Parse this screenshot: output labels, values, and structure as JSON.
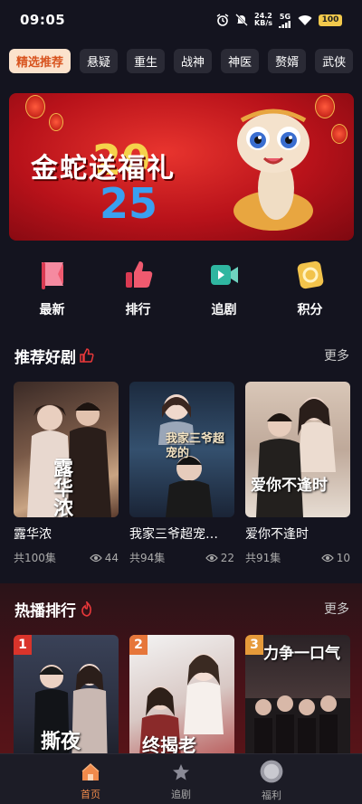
{
  "status_bar": {
    "time": "09:05",
    "net_speed_value": "24.2",
    "net_speed_unit": "KB/s",
    "signal": "5G",
    "battery": "100"
  },
  "categories": [
    "精选推荐",
    "悬疑",
    "重生",
    "战神",
    "神医",
    "赘婿",
    "武侠"
  ],
  "banner": {
    "title": "金蛇送福礼",
    "year_top": "20",
    "year_bottom": "25"
  },
  "quick_menu": [
    {
      "label": "最新",
      "icon": "flag-icon",
      "color": "#ef5a6f"
    },
    {
      "label": "排行",
      "icon": "thumbs-up-icon",
      "color": "#ef5a6f"
    },
    {
      "label": "追剧",
      "icon": "video-icon",
      "color": "#2fb6a0"
    },
    {
      "label": "积分",
      "icon": "coin-icon",
      "color": "#f2c34b"
    }
  ],
  "recommended": {
    "title": "推荐好剧",
    "more": "更多",
    "items": [
      {
        "title": "露华浓",
        "episodes": "共100集",
        "views": "44",
        "poster_text": "露华浓"
      },
      {
        "title": "我家三爷超宠…",
        "episodes": "共94集",
        "views": "22",
        "poster_text": "我家三爷超宠的"
      },
      {
        "title": "爱你不逢时",
        "episodes": "共91集",
        "views": "10",
        "poster_text": "爱你不逢时"
      }
    ]
  },
  "hot_ranking": {
    "title": "热播排行",
    "more": "更多",
    "items": [
      {
        "rank": "1",
        "poster_text": "撕夜",
        "badge_color": "#d9342b"
      },
      {
        "rank": "2",
        "poster_text": "终揭老",
        "badge_color": "#e6763a"
      },
      {
        "rank": "3",
        "poster_text": "力争一口气",
        "badge_color": "#e69a3a"
      }
    ]
  },
  "bottom_nav": [
    {
      "label": "首页",
      "icon": "home-icon",
      "active": true
    },
    {
      "label": "追剧",
      "icon": "star-icon",
      "active": false
    },
    {
      "label": "福利",
      "icon": "gift-icon",
      "active": false
    }
  ],
  "colors": {
    "accent": "#f08a4b",
    "active_tab_bg": "#fbe2cc",
    "active_tab_text": "#d8541f",
    "background": "#14141f"
  }
}
